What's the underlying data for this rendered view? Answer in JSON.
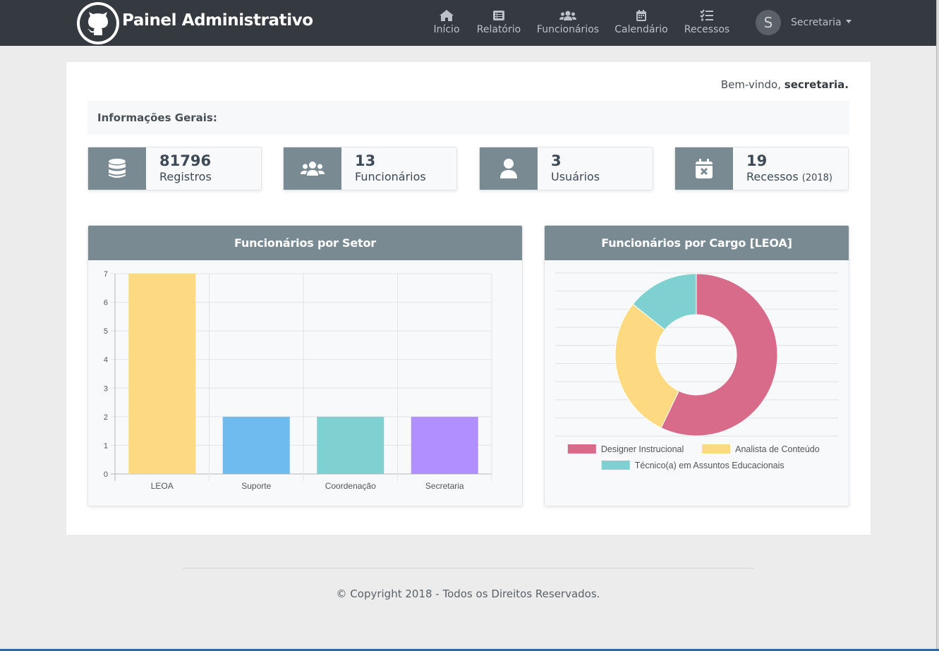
{
  "navbar": {
    "brand_title": "Painel Administrativo",
    "items": [
      {
        "label": "Início",
        "icon": "home-icon"
      },
      {
        "label": "Relatório",
        "icon": "list-icon"
      },
      {
        "label": "Funcionários",
        "icon": "users-icon"
      },
      {
        "label": "Calendário",
        "icon": "calendar-icon"
      },
      {
        "label": "Recessos",
        "icon": "checklist-icon"
      }
    ],
    "avatar_initial": "S",
    "user_label": "Secretaria"
  },
  "welcome": {
    "prefix": "Bem-vindo, ",
    "user": "secretaria."
  },
  "info_title": "Informações Gerais:",
  "stats": [
    {
      "value": "81796",
      "label": "Registros",
      "icon": "database-icon"
    },
    {
      "value": "13",
      "label": "Funcionários",
      "icon": "users-icon"
    },
    {
      "value": "3",
      "label": "Usuários",
      "icon": "user-icon"
    },
    {
      "value": "19",
      "label": "Recessos",
      "suffix": "(2018)",
      "icon": "calendar-x-icon"
    }
  ],
  "chart_data": [
    {
      "type": "bar",
      "title": "Funcionários por Setor",
      "categories": [
        "LEOA",
        "Suporte",
        "Coordenação",
        "Secretaria"
      ],
      "values": [
        7,
        2,
        2,
        2
      ],
      "colors": [
        "#fdda82",
        "#6fbaee",
        "#7fd1d1",
        "#b18ffc"
      ],
      "ylim": [
        0,
        7
      ],
      "yticks": [
        "0",
        "1",
        "2",
        "3",
        "4",
        "5",
        "6",
        "7"
      ],
      "grid": true
    },
    {
      "type": "pie",
      "variant": "doughnut",
      "title": "Funcionários por Cargo [LEOA]",
      "labels": [
        "Designer Instrucional",
        "Analista de Conteúdo",
        "Técnico(a) em Assuntos Educacionais"
      ],
      "values": [
        4,
        2,
        1
      ],
      "colors": [
        "#d86b89",
        "#fdda82",
        "#7fd1d1"
      ],
      "legend": "bottom"
    }
  ],
  "footer": "© Copyright 2018 - Todos os Direitos Reservados."
}
